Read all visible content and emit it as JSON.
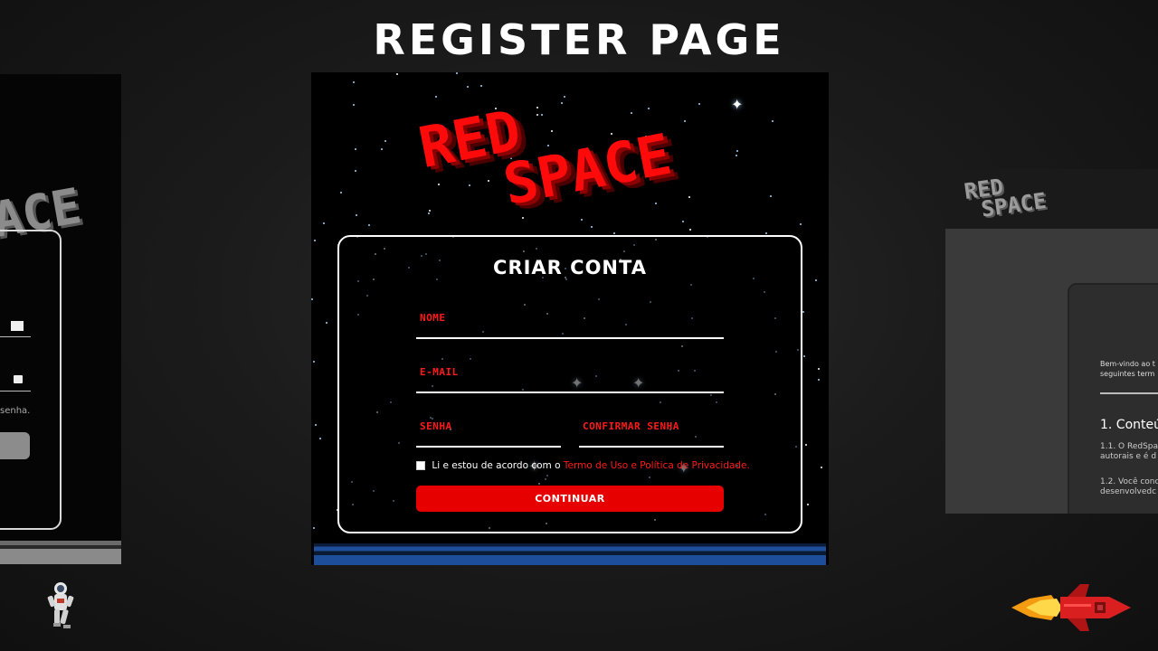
{
  "heading": "REGISTER PAGE",
  "left_preview": {
    "logo_fragment": "ACE",
    "forgot_text": "senha."
  },
  "main": {
    "logo_line1": "RED",
    "logo_line2": "SPACE",
    "form": {
      "title": "CRIAR CONTA",
      "name_label": "NOME",
      "email_label": "E-MAIL",
      "password_label": "SENHA",
      "confirm_password_label": "CONFIRMAR SENHA",
      "terms_text": "Li e estou de acordo com o",
      "terms_link": "Termo de Uso e Política de Privacidade.",
      "submit_label": "CONTINUAR"
    }
  },
  "right_preview": {
    "logo_line1": "RED",
    "logo_line2": "SPACE",
    "welcome_line1": "Bem-vindo ao t",
    "welcome_line2": "seguintes term",
    "section_heading": "1. Conteú",
    "para1_line1": "1.1. O RedSpac",
    "para1_line2": "autorais e é d",
    "para2_line1": "1.2. Você conc",
    "para2_line2": "desenvolvedc"
  },
  "colors": {
    "accent": "#e60000",
    "label_red": "#ff1a1a",
    "background": "#1b1b1b",
    "strip_blue": "#1e4f9b"
  },
  "icons": [
    "mail-icon",
    "lock-icon",
    "astronaut-icon",
    "rocket-icon",
    "sparkle-icon"
  ]
}
